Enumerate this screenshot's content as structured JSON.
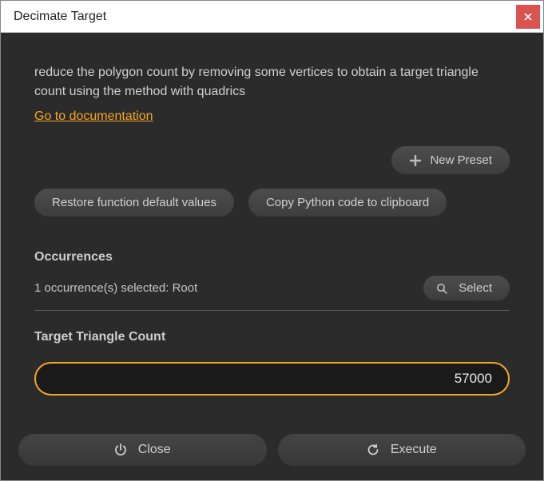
{
  "window": {
    "title": "Decimate Target"
  },
  "description": "reduce the polygon count by removing some vertices to obtain a target triangle count using the method with quadrics",
  "doc_link": "Go to documentation",
  "buttons": {
    "new_preset": "New Preset",
    "restore_defaults": "Restore function default values",
    "copy_python": "Copy Python code to clipboard",
    "select": "Select",
    "close": "Close",
    "execute": "Execute"
  },
  "sections": {
    "occurrences_label": "Occurrences",
    "occurrences_text": "1 occurrence(s) selected: Root",
    "target_label": "Target Triangle Count"
  },
  "inputs": {
    "target_triangle_count": "57000"
  },
  "colors": {
    "accent": "#f5a623",
    "close_btn": "#d9534f",
    "panel_bg": "#2b2b2b"
  }
}
